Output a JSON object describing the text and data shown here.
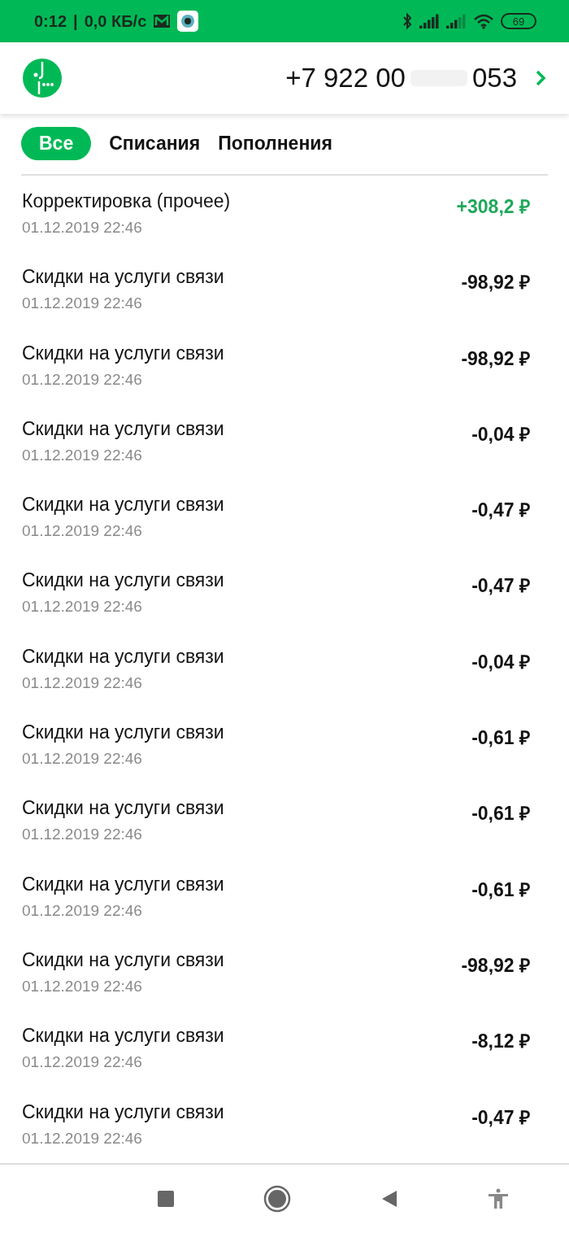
{
  "status_bar": {
    "time": "0:12",
    "separator": "|",
    "speed": "0,0 КБ/с",
    "battery": "69"
  },
  "header": {
    "phone_start": "+7 922 00",
    "phone_end": "053"
  },
  "tabs": [
    {
      "label": "Все",
      "selected": true
    },
    {
      "label": "Списания",
      "selected": false
    },
    {
      "label": "Пополнения",
      "selected": false
    }
  ],
  "transactions": [
    {
      "title": "Корректировка (прочее)",
      "date": "01.12.2019 22:46",
      "amount": "+308,2 ₽",
      "kind": "credit"
    },
    {
      "title": "Скидки на услуги связи",
      "date": "01.12.2019 22:46",
      "amount": "-98,92 ₽",
      "kind": "debit"
    },
    {
      "title": "Скидки на услуги связи",
      "date": "01.12.2019 22:46",
      "amount": "-98,92 ₽",
      "kind": "debit"
    },
    {
      "title": "Скидки на услуги связи",
      "date": "01.12.2019 22:46",
      "amount": "-0,04 ₽",
      "kind": "debit"
    },
    {
      "title": "Скидки на услуги связи",
      "date": "01.12.2019 22:46",
      "amount": "-0,47 ₽",
      "kind": "debit"
    },
    {
      "title": "Скидки на услуги связи",
      "date": "01.12.2019 22:46",
      "amount": "-0,47 ₽",
      "kind": "debit"
    },
    {
      "title": "Скидки на услуги связи",
      "date": "01.12.2019 22:46",
      "amount": "-0,04 ₽",
      "kind": "debit"
    },
    {
      "title": "Скидки на услуги связи",
      "date": "01.12.2019 22:46",
      "amount": "-0,61 ₽",
      "kind": "debit"
    },
    {
      "title": "Скидки на услуги связи",
      "date": "01.12.2019 22:46",
      "amount": "-0,61 ₽",
      "kind": "debit"
    },
    {
      "title": "Скидки на услуги связи",
      "date": "01.12.2019 22:46",
      "amount": "-0,61 ₽",
      "kind": "debit"
    },
    {
      "title": "Скидки на услуги связи",
      "date": "01.12.2019 22:46",
      "amount": "-98,92 ₽",
      "kind": "debit"
    },
    {
      "title": "Скидки на услуги связи",
      "date": "01.12.2019 22:46",
      "amount": "-8,12 ₽",
      "kind": "debit"
    },
    {
      "title": "Скидки на услуги связи",
      "date": "01.12.2019 22:46",
      "amount": "-0,47 ₽",
      "kind": "debit"
    }
  ]
}
